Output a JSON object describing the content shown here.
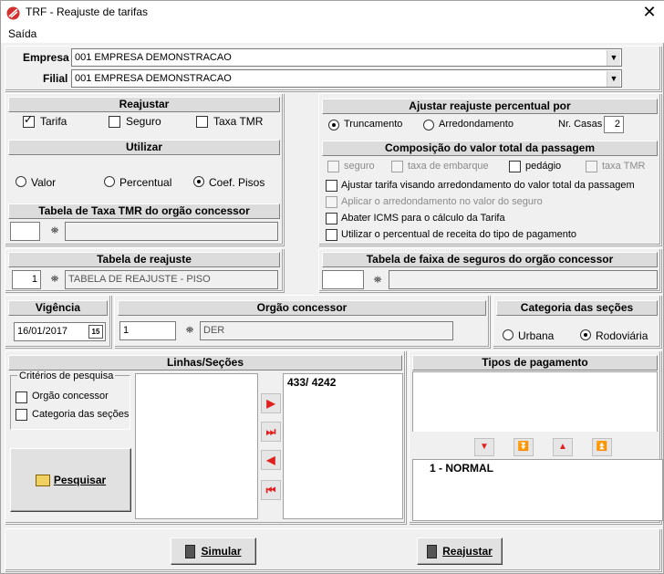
{
  "window": {
    "title": "TRF - Reajuste de tarifas"
  },
  "menu": {
    "saida": "Saída"
  },
  "empresa": {
    "label": "Empresa",
    "value": "001 EMPRESA DEMONSTRACAO"
  },
  "filial": {
    "label": "Filial",
    "value": "001 EMPRESA DEMONSTRACAO"
  },
  "reajustar": {
    "header": "Reajustar",
    "tarifa": "Tarifa",
    "seguro": "Seguro",
    "taxa_tmr": "Taxa TMR",
    "tarifa_checked": true,
    "seguro_checked": false,
    "taxa_tmr_checked": false
  },
  "utilizar": {
    "header": "Utilizar",
    "valor": "Valor",
    "percentual": "Percentual",
    "coef_pisos": "Coef. Pisos",
    "selected": "Coef. Pisos"
  },
  "tabela_tmr": {
    "header": "Tabela de Taxa TMR do orgão concessor",
    "code": "",
    "desc": ""
  },
  "ajustar": {
    "header": "Ajustar reajuste percentual por",
    "truncamento": "Truncamento",
    "arredondamento": "Arredondamento",
    "selected": "Truncamento",
    "nr_casas_label": "Nr. Casas",
    "nr_casas": "2"
  },
  "composicao": {
    "header": "Composição do valor total da passagem",
    "seguro": "seguro",
    "taxa_embarque": "taxa de embarque",
    "pedagio": "pedágio",
    "taxa_tmr": "taxa TMR"
  },
  "options": {
    "opt1": "Ajustar tarifa visando arredondamento do valor total da passagem",
    "opt2": "Aplicar o arredondamento no valor do seguro",
    "opt3": "Abater ICMS para o cálculo da Tarifa",
    "opt4": "Utilizar o percentual de receita do tipo de pagamento"
  },
  "tabela_reajuste": {
    "header": "Tabela de reajuste",
    "code": "1",
    "desc": "TABELA DE REAJUSTE - PISO"
  },
  "tabela_faixa": {
    "header": "Tabela de faixa de seguros do orgão concessor",
    "code": "",
    "desc": ""
  },
  "vigencia": {
    "header": "Vigência",
    "value": "16/01/2017",
    "cal_icon": "15"
  },
  "orgao": {
    "header": "Orgão concessor",
    "code": "1",
    "desc": "DER"
  },
  "categoria": {
    "header": "Categoria das seções",
    "urbana": "Urbana",
    "rodoviaria": "Rodoviária",
    "selected": "Rodoviária"
  },
  "linhas": {
    "header": "Linhas/Seções",
    "criterios": "Critérios de pesquisa",
    "orgao_concessor": "Orgão concessor",
    "categoria_secoes": "Categoria das seções",
    "pesquisar": "Pesquisar",
    "selected_items": [
      "433/ 4242"
    ]
  },
  "tipos": {
    "header": "Tipos de pagamento",
    "items": [
      "1 - NORMAL"
    ]
  },
  "buttons": {
    "simular": "Simular",
    "reajustar": "Reajustar"
  },
  "colors": {
    "arrow_red": "#e02020",
    "title_icon": "#d32f2f"
  }
}
